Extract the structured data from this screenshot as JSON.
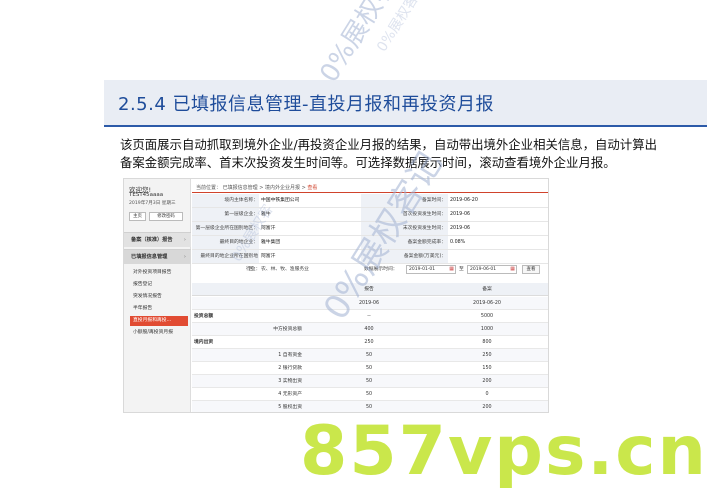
{
  "slide": {
    "title": "2.5.4 已填报信息管理-直投月报和再投资月报",
    "description": [
      "该页面展示自动抓取到境外企业/再投资企业月报的结果，自动带出境外企业相关信息，自动计算出",
      "备案金额完成率、首末次投资发生时间等。可选择数据展示时间，滚动查看境外企业月报。"
    ]
  },
  "app": {
    "sidebar": {
      "welcome": "欢迎您!",
      "username": "TEST45aaaa",
      "date": "2019年7月3日 星期三",
      "buttons": [
        "主页",
        "修改密码"
      ],
      "sections": [
        {
          "label": "备案（核准）报告"
        },
        {
          "label": "已填报信息管理"
        }
      ],
      "sub_items": [
        "对外投资项目报告",
        "报告登记",
        "突发情况报告",
        "半年报告",
        "直投月报和再投...",
        "小额股/再投资月报"
      ],
      "active_index": 4
    },
    "breadcrumb": {
      "prefix": "当前位置：",
      "items": [
        "已填报信息管理",
        "境内外企业月报",
        "查看"
      ]
    },
    "form": {
      "rows": [
        {
          "left_label": "境内主体名称：",
          "left_value": "中国中铁集团公司",
          "right_label": "备案时间：",
          "right_value": "2019-06-20"
        },
        {
          "left_label": "第一层级企业：",
          "left_value": "雅牛",
          "right_label": "首次投资发生时间：",
          "right_value": "2019-06"
        },
        {
          "left_label": "第一层级企业所在国别地区：",
          "left_value": "阿富汗",
          "right_label": "末次投资发生时间：",
          "right_value": "2019-06"
        },
        {
          "left_label": "最终目的地企业：",
          "left_value": "雅牛集团",
          "right_label": "备案金额完成率：",
          "right_value": "0.08%"
        },
        {
          "left_label": "最终目的地企业所在国别地区：",
          "left_value": "阿富汗",
          "right_label": "备案金额(万美元)：",
          "right_value": ""
        }
      ],
      "industry_label": "行业：",
      "industry_value": "农、林、牧、渔服务业",
      "period_label": "数据展示时间：",
      "start_date": "2019-01-01",
      "to_label": "至",
      "end_date": "2019-06-01",
      "query_label": "查看"
    },
    "table": {
      "headers": [
        "",
        "报告",
        "备案"
      ],
      "rows": [
        {
          "label": "",
          "c1": "2019-06",
          "c2": "2019-06-20",
          "type": "sub"
        },
        {
          "label": "投资总额",
          "c1": "--",
          "c2": "5000",
          "type": "group"
        },
        {
          "label": "中方投资总额",
          "c1": "400",
          "c2": "1000",
          "type": "indent"
        },
        {
          "label": "境内出资",
          "c1": "250",
          "c2": "800",
          "type": "group"
        },
        {
          "label": "1 自有资金",
          "c1": "50",
          "c2": "250",
          "type": "indent"
        },
        {
          "label": "2 银行贷款",
          "c1": "50",
          "c2": "150",
          "type": "indent"
        },
        {
          "label": "3 实物出资",
          "c1": "50",
          "c2": "200",
          "type": "indent"
        },
        {
          "label": "4 无形资产",
          "c1": "50",
          "c2": "0",
          "type": "indent"
        },
        {
          "label": "5 股权出资",
          "c1": "50",
          "c2": "200",
          "type": "indent"
        }
      ]
    }
  },
  "watermark": {
    "text1": "0%展权客记",
    "text2": "0%展权客记",
    "text3": "0%展权客",
    "text4": "0%展权客"
  },
  "brand_mark": "857vps.cn"
}
